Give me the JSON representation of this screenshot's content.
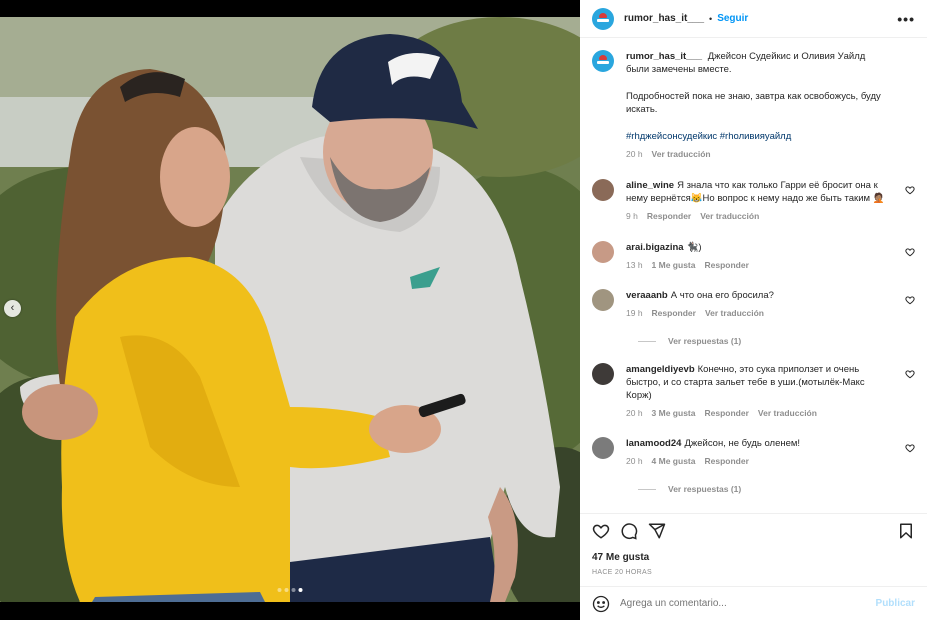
{
  "post": {
    "username": "rumor_has_it___",
    "follow_label": "Seguir",
    "more_label": "•••",
    "separator": "•"
  },
  "caption": {
    "username": "rumor_has_it___",
    "text1": "Джейсон Судейкис и Оливия Уайлд были замечены вместе.",
    "text2": "Подробностей пока не знаю, завтра как освобожусь, буду искать.",
    "tags": "#rhджейсонсудейкис #rhоливияуайлд",
    "time": "20 h",
    "translate": "Ver traducción"
  },
  "comments": [
    {
      "username": "aline_wine",
      "text": "Я знала что как только Гарри её бросит она к нему вернётся😹Но вопрос к нему надо же быть таким 🤦🏽",
      "time": "9 h",
      "likes": "",
      "reply": "Responder",
      "translate": "Ver traducción",
      "avatar_color": "#8a6a58"
    },
    {
      "username": "arai.bigazina",
      "text": "🐈‍⬛)",
      "time": "13 h",
      "likes": "1 Me gusta",
      "reply": "Responder",
      "translate": "",
      "avatar_color": "#c79a86"
    },
    {
      "username": "veraaanb",
      "text": "А что она его бросила?",
      "time": "19 h",
      "likes": "",
      "reply": "Responder",
      "translate": "Ver traducción",
      "replies": "Ver respuestas (1)",
      "avatar_color": "#a09580"
    },
    {
      "username": "amangeldiyevb",
      "text": "Конечно, это сука приползет и очень быстро, и со старта зальет тебе в уши.(мотылёк-Макс Корж)",
      "time": "20 h",
      "likes": "3 Me gusta",
      "reply": "Responder",
      "translate": "Ver traducción",
      "avatar_color": "#3e3a38"
    },
    {
      "username": "lanamood24",
      "text": "Джейсон, не будь оленем!",
      "time": "20 h",
      "likes": "4 Me gusta",
      "reply": "Responder",
      "translate": "",
      "replies": "Ver respuestas (1)",
      "avatar_color": "#7b7b7b"
    }
  ],
  "likes_count": "47 Me gusta",
  "posted": "HACE 20 HORAS",
  "add_comment": {
    "placeholder": "Agrega un comentario...",
    "post_label": "Publicar"
  },
  "carousel": {
    "total": 4,
    "active": 4
  },
  "colors": {
    "accent": "#0095f6",
    "tag": "#00376b",
    "muted": "#8e8e8e",
    "post_disabled": "#b2dffc"
  }
}
